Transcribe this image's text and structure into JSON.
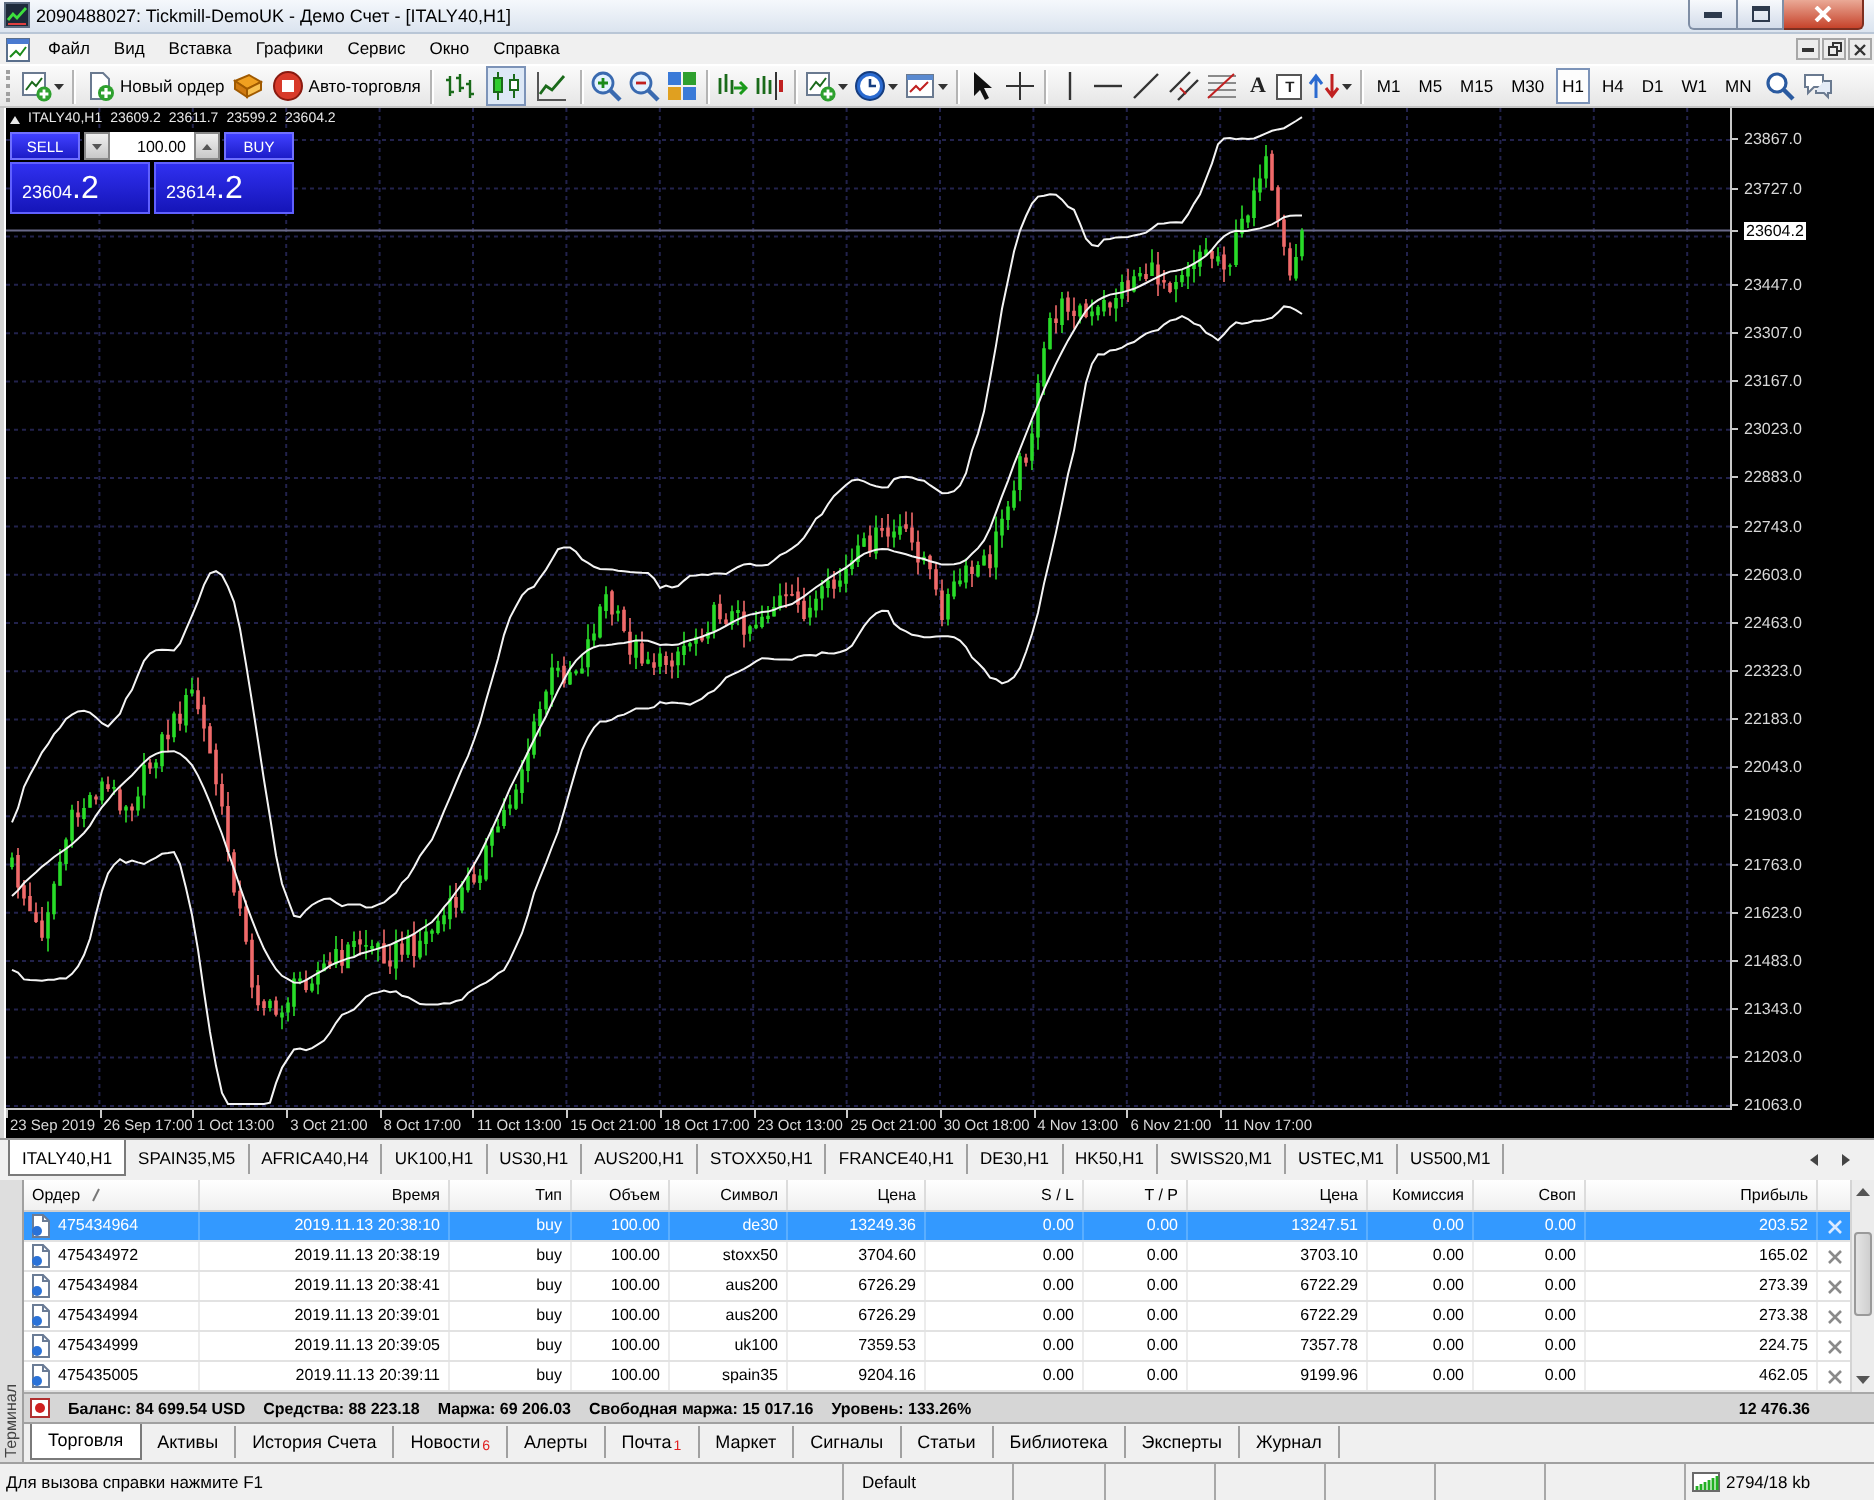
{
  "window": {
    "title": "2090488027: Tickmill-DemoUK - Демо Счет - [ITALY40,H1]"
  },
  "menu": [
    "Файл",
    "Вид",
    "Вставка",
    "Графики",
    "Сервис",
    "Окно",
    "Справка"
  ],
  "toolbar": {
    "buttons": [
      {
        "kind": "order",
        "label": "Новый ордер"
      },
      {
        "kind": "auto",
        "label": "Авто-торговля"
      }
    ],
    "chart_types": [
      {
        "kind": "bars",
        "selected": false
      },
      {
        "kind": "candles",
        "selected": true
      },
      {
        "kind": "line",
        "selected": false
      }
    ],
    "text_tools": [
      {
        "kind": "text",
        "glyph": "A"
      },
      {
        "kind": "label",
        "glyph": "T"
      }
    ],
    "timeframes": [
      {
        "label": "M1",
        "selected": false
      },
      {
        "label": "M5",
        "selected": false
      },
      {
        "label": "M15",
        "selected": false
      },
      {
        "label": "M30",
        "selected": false
      },
      {
        "label": "H1",
        "selected": true
      },
      {
        "label": "H4",
        "selected": false
      },
      {
        "label": "D1",
        "selected": false
      },
      {
        "label": "W1",
        "selected": false
      },
      {
        "label": "MN",
        "selected": false
      }
    ]
  },
  "chart": {
    "symbol": "ITALY40,H1",
    "ohlc": [
      "23609.2",
      "23611.7",
      "23599.2",
      "23604.2"
    ],
    "one_click": {
      "sell": "SELL",
      "buy": "BUY",
      "lot": "100.00",
      "sell_price": {
        "main": "23604",
        "pips": ".2"
      },
      "buy_price": {
        "main": "23614",
        "pips": ".2"
      }
    },
    "price_axis": [
      {
        "kind": "tick",
        "label": "23867.0"
      },
      {
        "kind": "tick",
        "label": "23727.0"
      },
      {
        "kind": "current",
        "label": "23604.2"
      },
      {
        "kind": "tick",
        "label": "23447.0"
      },
      {
        "kind": "tick",
        "label": "23307.0"
      },
      {
        "kind": "tick",
        "label": "23167.0"
      },
      {
        "kind": "tick",
        "label": "23023.0"
      },
      {
        "kind": "tick",
        "label": "22883.0"
      },
      {
        "kind": "tick",
        "label": "22743.0"
      },
      {
        "kind": "tick",
        "label": "22603.0"
      },
      {
        "kind": "tick",
        "label": "22463.0"
      },
      {
        "kind": "tick",
        "label": "22323.0"
      },
      {
        "kind": "tick",
        "label": "22183.0"
      },
      {
        "kind": "tick",
        "label": "22043.0"
      },
      {
        "kind": "tick",
        "label": "21903.0"
      },
      {
        "kind": "tick",
        "label": "21763.0"
      },
      {
        "kind": "tick",
        "label": "21623.0"
      },
      {
        "kind": "tick",
        "label": "21483.0"
      },
      {
        "kind": "tick",
        "label": "21343.0"
      },
      {
        "kind": "tick",
        "label": "21203.0"
      },
      {
        "kind": "tick",
        "label": "21063.0"
      }
    ],
    "time_axis": [
      "23 Sep 2019",
      "26 Sep 17:00",
      "1 Oct 13:00",
      "3 Oct 21:00",
      "8 Oct 17:00",
      "11 Oct 13:00",
      "15 Oct 21:00",
      "18 Oct 17:00",
      "23 Oct 13:00",
      "25 Oct 21:00",
      "30 Oct 18:00",
      "4 Nov 13:00",
      "6 Nov 21:00",
      "11 Nov 17:00"
    ]
  },
  "chart_tabs": [
    {
      "label": "ITALY40,H1",
      "selected": true
    },
    {
      "label": "SPAIN35,M5",
      "selected": false
    },
    {
      "label": "AFRICA40,H4",
      "selected": false
    },
    {
      "label": "UK100,H1",
      "selected": false
    },
    {
      "label": "US30,H1",
      "selected": false
    },
    {
      "label": "AUS200,H1",
      "selected": false
    },
    {
      "label": "STOXX50,H1",
      "selected": false
    },
    {
      "label": "FRANCE40,H1",
      "selected": false
    },
    {
      "label": "DE30,H1",
      "selected": false
    },
    {
      "label": "HK50,H1",
      "selected": false
    },
    {
      "label": "SWISS20,M1",
      "selected": false
    },
    {
      "label": "USTEC,M1",
      "selected": false
    },
    {
      "label": "US500,M1",
      "selected": false
    }
  ],
  "terminal": {
    "label": "Терминал",
    "columns": [
      {
        "label": "Ордер",
        "sorted": true
      },
      {
        "label": "Время",
        "sorted": false
      },
      {
        "label": "Тип",
        "sorted": false
      },
      {
        "label": "Объем",
        "sorted": false
      },
      {
        "label": "Символ",
        "sorted": false
      },
      {
        "label": "Цена",
        "sorted": false
      },
      {
        "label": "S / L",
        "sorted": false
      },
      {
        "label": "T / P",
        "sorted": false
      },
      {
        "label": "Цена",
        "sorted": false
      },
      {
        "label": "Комиссия",
        "sorted": false
      },
      {
        "label": "Своп",
        "sorted": false
      },
      {
        "label": "Прибыль",
        "sorted": false
      }
    ],
    "rows": [
      {
        "selected": true,
        "cells": [
          "475434964",
          "2019.11.13 20:38:10",
          "buy",
          "100.00",
          "de30",
          "13249.36",
          "0.00",
          "0.00",
          "13247.51",
          "0.00",
          "0.00",
          "203.52"
        ]
      },
      {
        "selected": false,
        "cells": [
          "475434972",
          "2019.11.13 20:38:19",
          "buy",
          "100.00",
          "stoxx50",
          "3704.60",
          "0.00",
          "0.00",
          "3703.10",
          "0.00",
          "0.00",
          "165.02"
        ]
      },
      {
        "selected": false,
        "cells": [
          "475434984",
          "2019.11.13 20:38:41",
          "buy",
          "100.00",
          "aus200",
          "6726.29",
          "0.00",
          "0.00",
          "6722.29",
          "0.00",
          "0.00",
          "273.39"
        ]
      },
      {
        "selected": false,
        "cells": [
          "475434994",
          "2019.11.13 20:39:01",
          "buy",
          "100.00",
          "aus200",
          "6726.29",
          "0.00",
          "0.00",
          "6722.29",
          "0.00",
          "0.00",
          "273.38"
        ]
      },
      {
        "selected": false,
        "cells": [
          "475434999",
          "2019.11.13 20:39:05",
          "buy",
          "100.00",
          "uk100",
          "7359.53",
          "0.00",
          "0.00",
          "7357.78",
          "0.00",
          "0.00",
          "224.75"
        ]
      },
      {
        "selected": false,
        "cells": [
          "475435005",
          "2019.11.13 20:39:11",
          "buy",
          "100.00",
          "spain35",
          "9204.16",
          "0.00",
          "0.00",
          "9199.96",
          "0.00",
          "0.00",
          "462.05"
        ]
      }
    ],
    "summary": {
      "balance": "Баланс: 84 699.54 USD",
      "equity": "Средства: 88 223.18",
      "margin": "Маржа: 69 206.03",
      "free_margin": "Свободная маржа: 15 017.16",
      "level": "Уровень: 133.26%",
      "profit": "12 476.36"
    },
    "tabs": [
      {
        "label": "Торговля",
        "selected": true
      },
      {
        "label": "Активы",
        "selected": false
      },
      {
        "label": "История Счета",
        "selected": false
      },
      {
        "label": "Новости",
        "badge": "6",
        "selected": false
      },
      {
        "label": "Алерты",
        "selected": false
      },
      {
        "label": "Почта",
        "badge": "1",
        "selected": false
      },
      {
        "label": "Маркет",
        "selected": false
      },
      {
        "label": "Сигналы",
        "selected": false
      },
      {
        "label": "Статьи",
        "selected": false
      },
      {
        "label": "Библиотека",
        "selected": false
      },
      {
        "label": "Эксперты",
        "selected": false
      },
      {
        "label": "Журнал",
        "selected": false
      }
    ]
  },
  "status_bar": {
    "help": "Для вызова справки нажмите F1",
    "profile": "Default",
    "traffic": "2794/18 kb"
  }
}
